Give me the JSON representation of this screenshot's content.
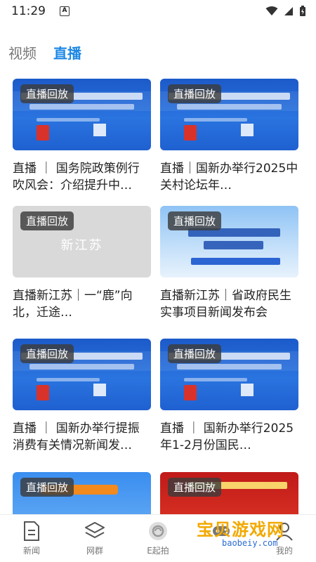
{
  "status": {
    "time": "11:29",
    "notify_icon_letter": "A"
  },
  "tabs": [
    {
      "label": "视频",
      "active": false
    },
    {
      "label": "直播",
      "active": true
    }
  ],
  "cards": [
    {
      "badge": "直播回放",
      "title": "直播 ｜ 国务院政策例行吹风会：介绍提升中…",
      "thumb_style": "blue"
    },
    {
      "badge": "直播回放",
      "title": "直播｜国新办举行2025中关村论坛年…",
      "thumb_style": "blue"
    },
    {
      "badge": "直播回放",
      "title": "直播新江苏｜一“鹿”向北，迁途…",
      "thumb_style": "gray",
      "thumb_text": "新江苏"
    },
    {
      "badge": "直播回放",
      "title": "直播新江苏｜省政府民生实事项目新闻发布会",
      "thumb_style": "light"
    },
    {
      "badge": "直播回放",
      "title": "直播 ｜ 国新办举行提振消费有关情况新闻发…",
      "thumb_style": "blue"
    },
    {
      "badge": "直播回放",
      "title": "直播 ｜ 国新办举行2025年1-2月份国民…",
      "thumb_style": "blue"
    },
    {
      "badge": "直播回放",
      "title": "",
      "thumb_style": "bluebanner"
    },
    {
      "badge": "直播回放",
      "title": "",
      "thumb_style": "red"
    }
  ],
  "bottom_nav": [
    {
      "label": "新闻",
      "icon": "news-icon"
    },
    {
      "label": "网群",
      "icon": "layers-icon"
    },
    {
      "label": "E起拍",
      "icon": "camera-icon"
    },
    {
      "label": "",
      "icon": "gamepad-icon"
    },
    {
      "label": "我的",
      "icon": "profile-icon"
    }
  ],
  "watermark": {
    "main": "宝贝游戏网",
    "sub": "baobeiy.com"
  },
  "colors": {
    "accent": "#1e88e5",
    "badge_bg": "#3c3c3c"
  }
}
